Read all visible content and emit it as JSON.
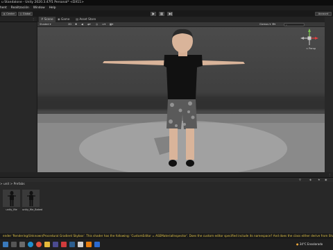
{
  "window": {
    "title": "u Standalone - Unity 2020.3.47f1 Personal* <DX11>"
  },
  "menu": [
    "hent",
    "Realitzación",
    "Window",
    "Help"
  ],
  "toolbar": {
    "left_buttons": [
      "Center",
      "Global"
    ],
    "account_label": "Account"
  },
  "scene_view": {
    "tabs": [
      "Scene",
      "Game",
      "Asset Store"
    ],
    "shading_mode": "Shaded",
    "mode_2d": "2D",
    "gizmos_label": "Gizmos",
    "persp_label": "< Persp"
  },
  "project": {
    "breadcrumb": "> unit > Prefabs",
    "assets": [
      {
        "name": "unity_file",
        "icon": "character-prefab-icon"
      },
      {
        "name": "unity_file_Baked",
        "icon": "character-prefab-icon"
      }
    ]
  },
  "status": {
    "message": "ender 'Rendering/Unknown/Procedural Gradient Skybox'. This shader has the following: 'CustomEditor = ASEMaterialInspector'. Does the custom editor specified include its namespace? And does the class either derive from ShaderGUI or MaterialEditor?"
  },
  "taskbar": {
    "weather": "34°C Ensolarado",
    "icons": [
      "search-icon",
      "task-view-icon",
      "edge-icon",
      "chrome-icon",
      "explorer-icon",
      "store-icon",
      "mail-icon",
      "steam-icon",
      "unity-icon",
      "blender-icon",
      "photoshop-icon"
    ]
  },
  "colors": {
    "accent": "#3a79bb",
    "warning": "#e6c84a",
    "panel": "#282828"
  }
}
